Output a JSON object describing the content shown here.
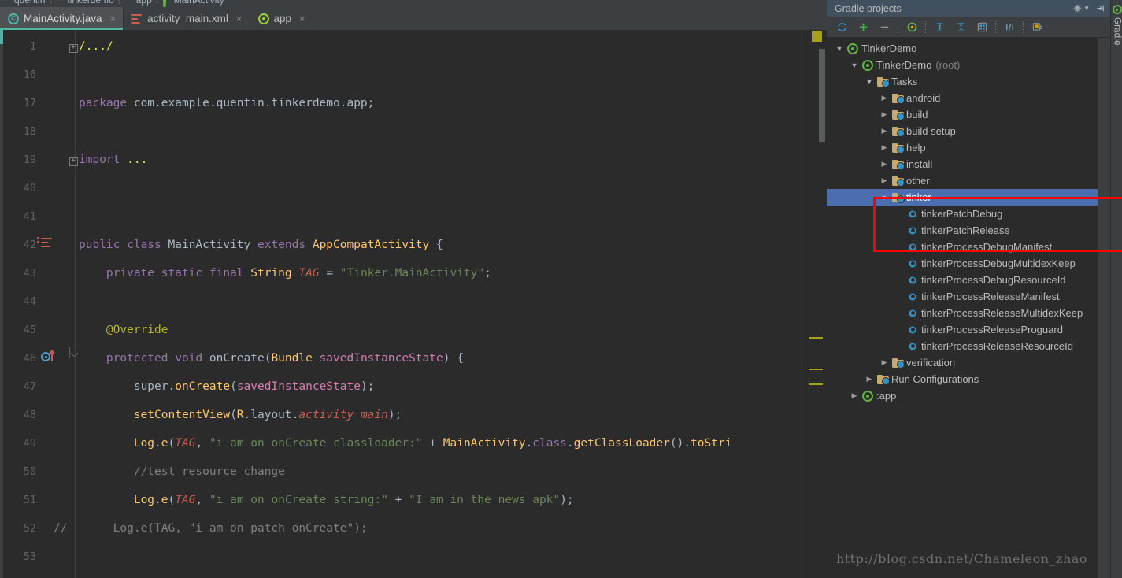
{
  "breadcrumb": [
    {
      "label": "quentin",
      "icon": "folder-icon"
    },
    {
      "label": "tinkerdemo",
      "icon": "folder-icon"
    },
    {
      "label": "app",
      "icon": "folder-icon"
    },
    {
      "label": "MainActivity",
      "icon": "class-icon"
    }
  ],
  "tabs": [
    {
      "label": "MainActivity.java",
      "icon": "java-class-icon",
      "close": "×",
      "active": true
    },
    {
      "label": "activity_main.xml",
      "icon": "xml-layout-icon",
      "close": "×",
      "active": false
    },
    {
      "label": "app",
      "icon": "android-module-icon",
      "close": "×",
      "active": false
    }
  ],
  "editor": {
    "lines": [
      {
        "num": "1",
        "fold": "+",
        "code_html": "<span class=\"yel\">/.../</span>"
      },
      {
        "num": "16",
        "code_html": ""
      },
      {
        "num": "17",
        "code_html": "<span class=\"kw2\">package</span> <span class=\"plain\">com.example.quentin.tinkerdemo.app;</span>"
      },
      {
        "num": "18",
        "code_html": ""
      },
      {
        "num": "19",
        "fold": "+",
        "code_html": "<span class=\"kw2\">import</span> <span class=\"yel\">...</span>"
      },
      {
        "num": "40",
        "code_html": ""
      },
      {
        "num": "41",
        "code_html": ""
      },
      {
        "num": "42",
        "gutter": "override-impl",
        "code_html": "<span class=\"kw2\">public class</span> <span class=\"plain\">MainActivity</span> <span class=\"kw2\">extends</span> <span class=\"meth\">AppCompatActivity</span> <span class=\"plain\">{</span>"
      },
      {
        "num": "43",
        "code_html": "    <span class=\"kw2\">private static final</span> <span class=\"meth\">String</span> <span class=\"stat\" style=\"color:#cc5b52\">TAG</span> <span class=\"plain\">=</span> <span class=\"str\">\"Tinker.MainActivity\"</span><span class=\"plain\">;</span>"
      },
      {
        "num": "44",
        "code_html": ""
      },
      {
        "num": "45",
        "code_html": "    <span class=\"anno\">@Override</span>"
      },
      {
        "num": "46",
        "gutter": "overriding-method",
        "foldcap": true,
        "code_html": "    <span class=\"kw2\">protected void</span> <span class=\"plain\">onCreate(</span><span class=\"meth\">Bundle</span> <span class=\"pnk\">savedInstanceState</span><span class=\"plain\">) {</span>"
      },
      {
        "num": "47",
        "code_html": "        <span class=\"plain\">super.</span><span class=\"meth\">onCreate</span><span class=\"plain\">(</span><span class=\"pnk\">savedInstanceState</span><span class=\"plain\">);</span>"
      },
      {
        "num": "48",
        "code_html": "        <span class=\"meth\">setContentView</span><span class=\"plain\">(</span><span class=\"meth\">R</span><span class=\"plain\">.layout.</span><span class=\"stat\" style=\"color:#cc5b52\">activity_main</span><span class=\"plain\">);</span>"
      },
      {
        "num": "49",
        "code_html": "        <span class=\"meth\">Log</span><span class=\"plain\">.</span><span class=\"meth\">e</span><span class=\"plain\">(</span><span class=\"stat\" style=\"color:#cc5b52\">TAG</span><span class=\"plain\">,</span> <span class=\"str\">\"i am on onCreate classloader:\"</span> <span class=\"plain\">+</span> <span class=\"meth\">MainActivity</span><span class=\"plain\">.</span><span class=\"kw2\">class</span><span class=\"plain\">.</span><span class=\"meth\">getClassLoader</span><span class=\"plain\">().</span><span class=\"meth\">toStri</span>"
      },
      {
        "num": "50",
        "code_html": "        <span class=\"cmt\">//test resource change</span>"
      },
      {
        "num": "51",
        "code_html": "        <span class=\"meth\">Log</span><span class=\"plain\">.</span><span class=\"meth\">e</span><span class=\"plain\">(</span><span class=\"stat\" style=\"color:#cc5b52\">TAG</span><span class=\"plain\">,</span> <span class=\"str\">\"i am on onCreate string:\"</span> <span class=\"plain\">+</span> <span class=\"str\">\"I am in the news apk\"</span><span class=\"plain\">);</span>"
      },
      {
        "num": "52",
        "prefix": "//",
        "code_html": "<span class=\"cmt\">     Log.e(TAG, \"i am on patch onCreate\");</span>"
      },
      {
        "num": "53",
        "code_html": ""
      }
    ]
  },
  "gradle": {
    "title": "Gradle projects",
    "header_icons": [
      "gear-dropdown-icon",
      "collapse-panel-icon"
    ],
    "toolbar_icons": [
      "refresh-icon",
      "add-icon",
      "remove-icon",
      "attach-gradle-project-icon",
      "expand-all-icon",
      "collapse-all-icon",
      "toggle-offline-icon",
      "execute-task-icon",
      "gradle-settings-icon"
    ],
    "tree": [
      {
        "label": "TinkerDemo",
        "sub": "",
        "depth": 0,
        "twisty": "open",
        "icon": "gradle-project-icon",
        "selected": false
      },
      {
        "label": "TinkerDemo",
        "sub": "(root)",
        "depth": 1,
        "twisty": "open",
        "icon": "gradle-project-icon",
        "selected": false
      },
      {
        "label": "Tasks",
        "sub": "",
        "depth": 2,
        "twisty": "open",
        "icon": "task-folder-icon",
        "selected": false
      },
      {
        "label": "android",
        "sub": "",
        "depth": 3,
        "twisty": "closed",
        "icon": "task-folder-icon",
        "selected": false
      },
      {
        "label": "build",
        "sub": "",
        "depth": 3,
        "twisty": "closed",
        "icon": "task-folder-icon",
        "selected": false
      },
      {
        "label": "build setup",
        "sub": "",
        "depth": 3,
        "twisty": "closed",
        "icon": "task-folder-icon",
        "selected": false
      },
      {
        "label": "help",
        "sub": "",
        "depth": 3,
        "twisty": "closed",
        "icon": "task-folder-icon",
        "selected": false
      },
      {
        "label": "install",
        "sub": "",
        "depth": 3,
        "twisty": "closed",
        "icon": "task-folder-icon",
        "selected": false
      },
      {
        "label": "other",
        "sub": "",
        "depth": 3,
        "twisty": "closed",
        "icon": "task-folder-icon",
        "selected": false
      },
      {
        "label": "tinker",
        "sub": "",
        "depth": 3,
        "twisty": "open",
        "icon": "task-folder-icon",
        "selected": true
      },
      {
        "label": "tinkerPatchDebug",
        "sub": "",
        "depth": 4,
        "twisty": "none",
        "icon": "gradle-task-icon",
        "selected": false
      },
      {
        "label": "tinkerPatchRelease",
        "sub": "",
        "depth": 4,
        "twisty": "none",
        "icon": "gradle-task-icon",
        "selected": false
      },
      {
        "label": "tinkerProcessDebugManifest",
        "sub": "",
        "depth": 4,
        "twisty": "none",
        "icon": "gradle-task-icon",
        "selected": false
      },
      {
        "label": "tinkerProcessDebugMultidexKeep",
        "sub": "",
        "depth": 4,
        "twisty": "none",
        "icon": "gradle-task-icon",
        "selected": false
      },
      {
        "label": "tinkerProcessDebugResourceId",
        "sub": "",
        "depth": 4,
        "twisty": "none",
        "icon": "gradle-task-icon",
        "selected": false
      },
      {
        "label": "tinkerProcessReleaseManifest",
        "sub": "",
        "depth": 4,
        "twisty": "none",
        "icon": "gradle-task-icon",
        "selected": false
      },
      {
        "label": "tinkerProcessReleaseMultidexKeep",
        "sub": "",
        "depth": 4,
        "twisty": "none",
        "icon": "gradle-task-icon",
        "selected": false
      },
      {
        "label": "tinkerProcessReleaseProguard",
        "sub": "",
        "depth": 4,
        "twisty": "none",
        "icon": "gradle-task-icon",
        "selected": false
      },
      {
        "label": "tinkerProcessReleaseResourceId",
        "sub": "",
        "depth": 4,
        "twisty": "none",
        "icon": "gradle-task-icon",
        "selected": false
      },
      {
        "label": "verification",
        "sub": "",
        "depth": 3,
        "twisty": "closed",
        "icon": "task-folder-icon",
        "selected": false
      },
      {
        "label": "Run Configurations",
        "sub": "",
        "depth": 2,
        "twisty": "closed",
        "icon": "task-folder-icon",
        "selected": false
      },
      {
        "label": ":app",
        "sub": "",
        "depth": 1,
        "twisty": "closed",
        "icon": "gradle-project-icon",
        "selected": false
      }
    ]
  },
  "right_tool_tab": {
    "label": "Gradle",
    "icon": "gradle-icon"
  },
  "annotation": {
    "type": "red-rectangle",
    "color": "#ff0000"
  },
  "watermark": {
    "text": "http://blog.csdn.net/Chameleon_zhao"
  },
  "colors": {
    "editor_bg": "#2b2b2b",
    "panel_bg": "#3c3f41",
    "selection_blue": "#4b6eaf",
    "accent_teal": "#4eb8a0",
    "annotation_red": "#ff0000",
    "warning_stripe": "#a6a118"
  }
}
